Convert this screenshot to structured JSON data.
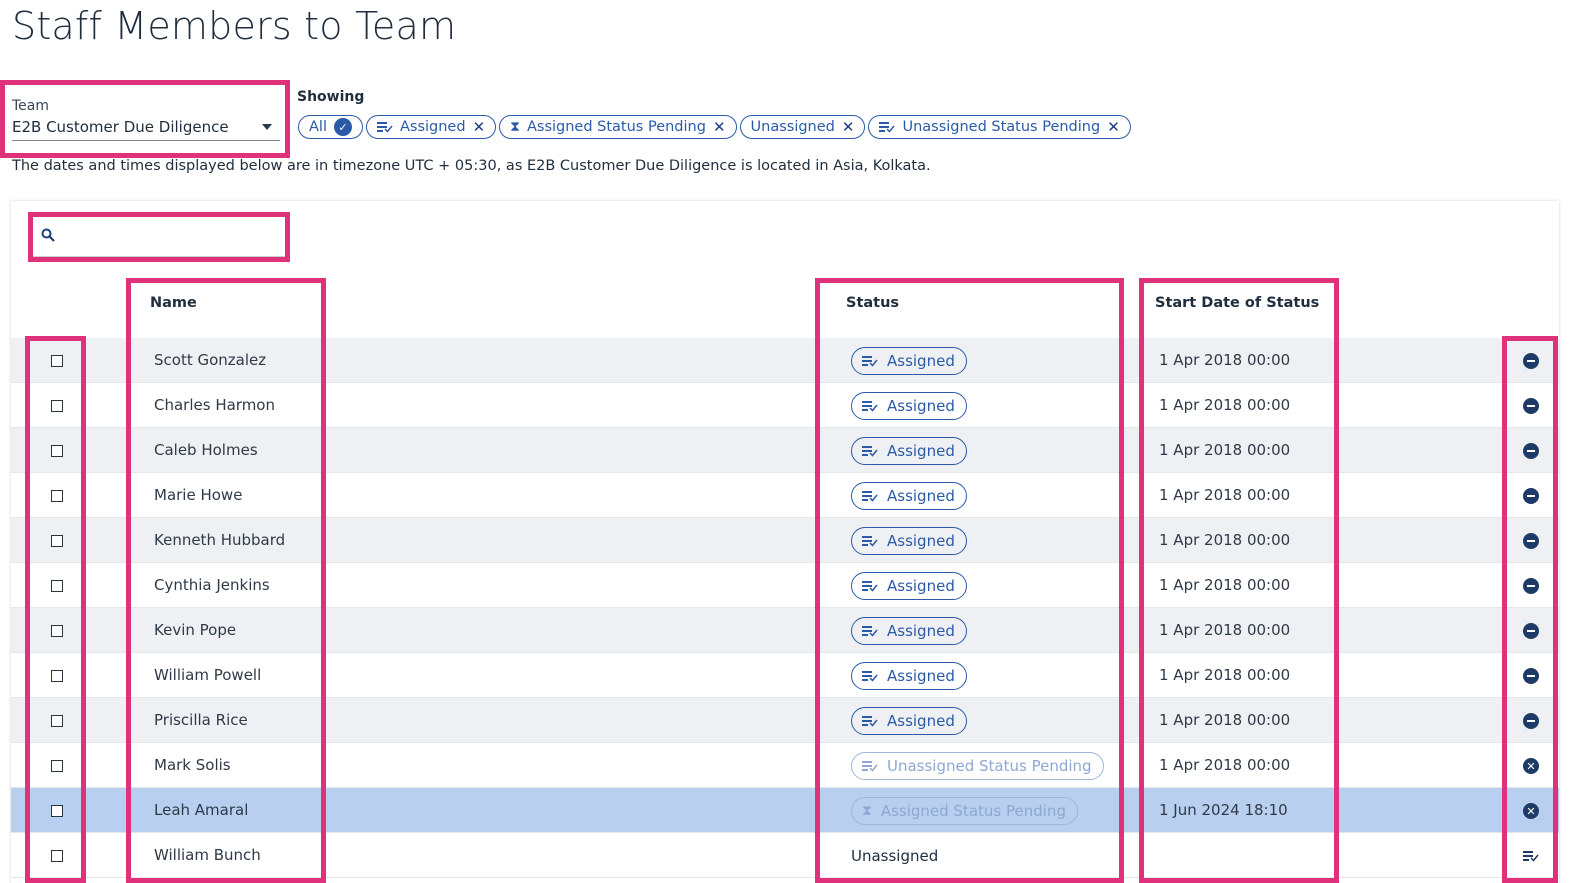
{
  "page": {
    "title": "Staff Members to Team"
  },
  "team": {
    "label": "Team",
    "value": "E2B Customer Due Diligence"
  },
  "filters": {
    "label": "Showing",
    "chips": [
      {
        "label": "All",
        "icon": "check-circle-icon"
      },
      {
        "label": "Assigned",
        "icon": "list-check-icon"
      },
      {
        "label": "Assigned Status Pending",
        "icon": "hourglass-icon"
      },
      {
        "label": "Unassigned",
        "icon": ""
      },
      {
        "label": "Unassigned Status Pending",
        "icon": "list-check-icon"
      }
    ]
  },
  "timezone_note": "The dates and times displayed below are in timezone UTC + 05:30, as E2B Customer Due Diligence is located in Asia, Kolkata.",
  "search": {
    "placeholder": "",
    "icon": "search-icon"
  },
  "table": {
    "headers": {
      "name": "Name",
      "status": "Status",
      "start_date": "Start Date of Status"
    },
    "rows": [
      {
        "name": "Scott Gonzalez",
        "status": "Assigned",
        "date": "1 Apr 2018 00:00",
        "action": "remove-icon"
      },
      {
        "name": "Charles Harmon",
        "status": "Assigned",
        "date": "1 Apr 2018 00:00",
        "action": "remove-icon"
      },
      {
        "name": "Caleb Holmes",
        "status": "Assigned",
        "date": "1 Apr 2018 00:00",
        "action": "remove-icon"
      },
      {
        "name": "Marie Howe",
        "status": "Assigned",
        "date": "1 Apr 2018 00:00",
        "action": "remove-icon"
      },
      {
        "name": "Kenneth Hubbard",
        "status": "Assigned",
        "date": "1 Apr 2018 00:00",
        "action": "remove-icon"
      },
      {
        "name": "Cynthia Jenkins",
        "status": "Assigned",
        "date": "1 Apr 2018 00:00",
        "action": "remove-icon"
      },
      {
        "name": "Kevin Pope",
        "status": "Assigned",
        "date": "1 Apr 2018 00:00",
        "action": "remove-icon"
      },
      {
        "name": "William Powell",
        "status": "Assigned",
        "date": "1 Apr 2018 00:00",
        "action": "remove-icon"
      },
      {
        "name": "Priscilla Rice",
        "status": "Assigned",
        "date": "1 Apr 2018 00:00",
        "action": "remove-icon"
      },
      {
        "name": "Mark Solis",
        "status": "Unassigned Status Pending",
        "date": "1 Apr 2018 00:00",
        "action": "cancel-icon"
      },
      {
        "name": "Leah Amaral",
        "status": "Assigned Status Pending",
        "date": "1 Jun 2024 18:10",
        "action": "cancel-icon"
      },
      {
        "name": "William Bunch",
        "status": "Unassigned",
        "date": "",
        "action": "assign-icon"
      }
    ]
  },
  "colors": {
    "accent": "#2b5aa8",
    "highlight": "#e0327a",
    "selected_row": "#b8cff0"
  }
}
